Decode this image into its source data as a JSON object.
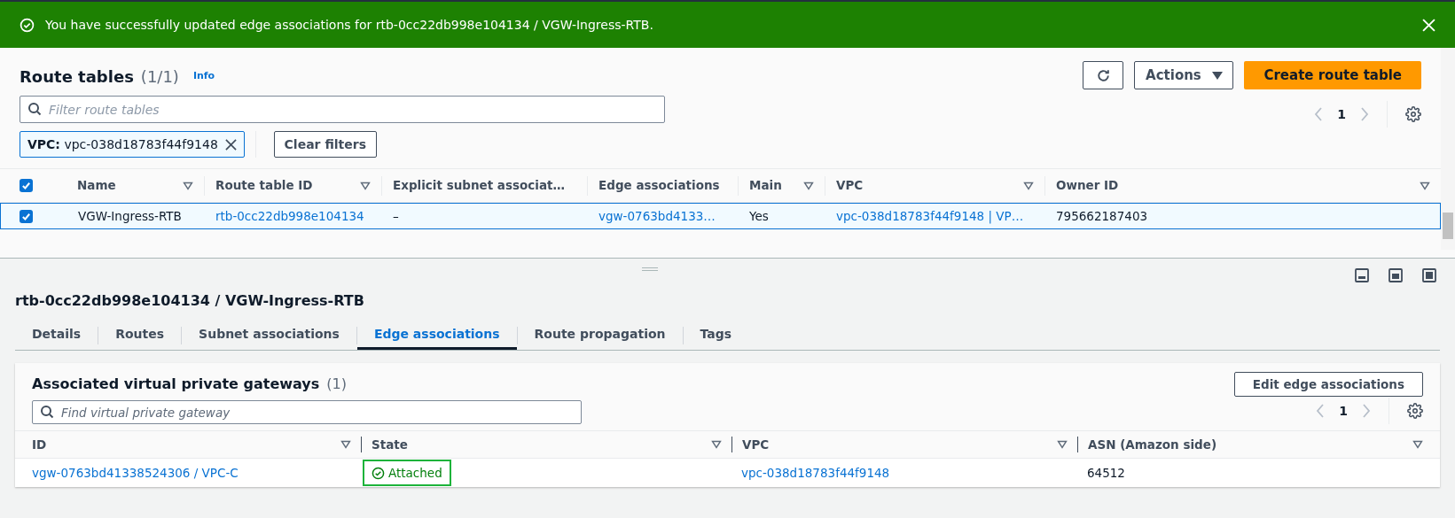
{
  "flash": {
    "message": "You have successfully updated edge associations for rtb-0cc22db998e104134 / VGW-Ingress-RTB."
  },
  "route_tables": {
    "title": "Route tables",
    "count": "(1/1)",
    "info": "Info",
    "actions": [
      {
        "kind": "refresh"
      },
      {
        "kind": "dropdown",
        "label": "Actions"
      },
      {
        "kind": "primary",
        "label": "Create route table"
      }
    ],
    "filter": {
      "placeholder": "Filter route tables"
    },
    "chip": {
      "key": "VPC:",
      "value": "vpc-038d18783f44f9148"
    },
    "clear_filters": "Clear filters",
    "pagination": {
      "page": "1"
    },
    "all_checked": true,
    "columns": [
      {
        "label": "Name",
        "sortable": true
      },
      {
        "label": "Route table ID",
        "sortable": true
      },
      {
        "label": "Explicit subnet associat…",
        "sortable": false
      },
      {
        "label": "Edge associations",
        "sortable": false
      },
      {
        "label": "Main",
        "sortable": true
      },
      {
        "label": "VPC",
        "sortable": true
      },
      {
        "label": "Owner ID",
        "sortable": true
      }
    ],
    "rows": [
      {
        "checked": true,
        "cells": [
          {
            "kind": "text",
            "text": "VGW-Ingress-RTB"
          },
          {
            "kind": "link",
            "text": "rtb-0cc22db998e104134"
          },
          {
            "kind": "text",
            "text": "–"
          },
          {
            "kind": "link",
            "text": "vgw-0763bd4133…"
          },
          {
            "kind": "text",
            "text": "Yes"
          },
          {
            "kind": "link",
            "text": "vpc-038d18783f44f9148 | VP…"
          },
          {
            "kind": "text",
            "text": "795662187403"
          }
        ]
      }
    ]
  },
  "details": {
    "title": "rtb-0cc22db998e104134 / VGW-Ingress-RTB",
    "tabs": [
      {
        "label": "Details",
        "selected": false
      },
      {
        "label": "Routes",
        "selected": false
      },
      {
        "label": "Subnet associations",
        "selected": false
      },
      {
        "label": "Edge associations",
        "selected": true
      },
      {
        "label": "Route propagation",
        "selected": false
      },
      {
        "label": "Tags",
        "selected": false
      }
    ],
    "card": {
      "title": "Associated virtual private gateways",
      "count": "(1)",
      "edit_button": "Edit edge associations",
      "search": {
        "placeholder": "Find virtual private gateway"
      },
      "pagination": {
        "page": "1"
      },
      "columns": [
        {
          "label": "ID"
        },
        {
          "label": "State"
        },
        {
          "label": "VPC"
        },
        {
          "label": "ASN (Amazon side)"
        }
      ],
      "rows": [
        {
          "cells": [
            {
              "kind": "link",
              "text": "vgw-0763bd41338524306 / VPC-C"
            },
            {
              "kind": "status",
              "text": "Attached",
              "highlighted": true
            },
            {
              "kind": "link",
              "text": "vpc-038d18783f44f9148"
            },
            {
              "kind": "text",
              "text": "64512"
            }
          ]
        }
      ]
    }
  }
}
